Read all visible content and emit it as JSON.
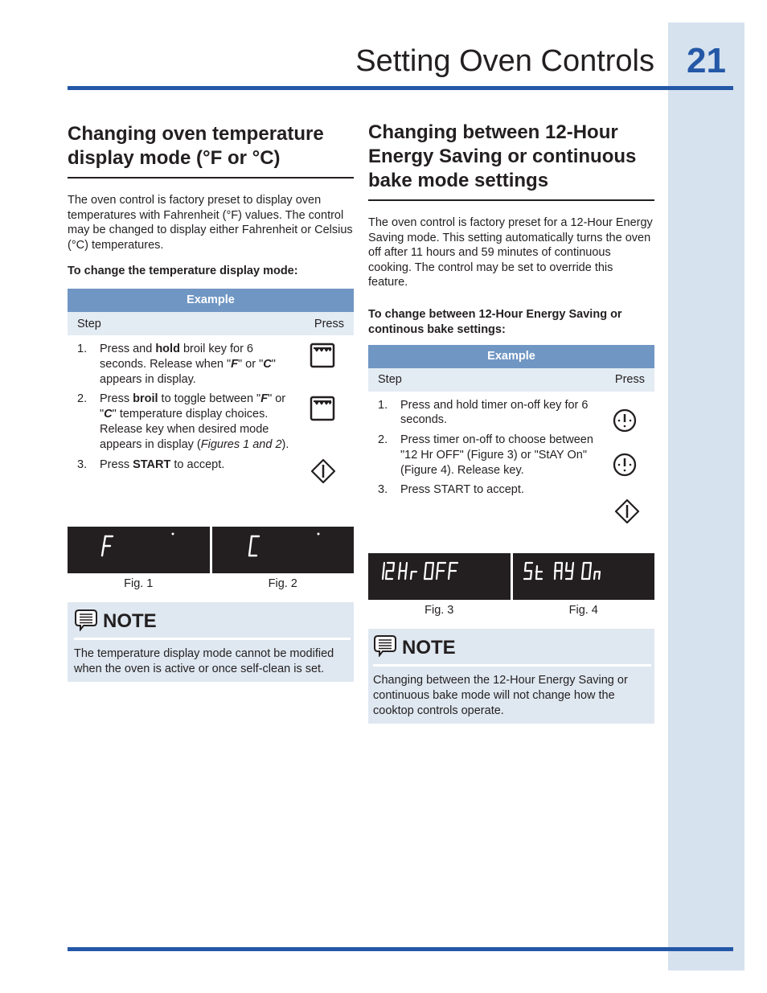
{
  "header": {
    "title": "Setting Oven Controls",
    "page_number": "21"
  },
  "left_section": {
    "heading": "Changing oven temperature display mode (°F or °C)",
    "intro": "The oven control is factory preset to display oven temperatures with Fahrenheit (°F) values. The control may be changed to display either Fahrenheit or Celsius (°C) temperatures.",
    "subheading": "To change the temperature display mode:",
    "table": {
      "title": "Example",
      "col_step": "Step",
      "col_press": "Press",
      "steps": [
        {
          "num": "1.",
          "parts": [
            [
              "",
              "Press and "
            ],
            [
              "b",
              "hold"
            ],
            [
              "",
              " broil key for 6 seconds. Release when \""
            ],
            [
              "bi",
              "F"
            ],
            [
              "",
              "\" or \""
            ],
            [
              "bi",
              "C"
            ],
            [
              "",
              "\" appears in display."
            ]
          ],
          "icon": "broil-key-icon"
        },
        {
          "num": "2.",
          "parts": [
            [
              "",
              "Press "
            ],
            [
              "b",
              "broil"
            ],
            [
              "",
              " to toggle between \""
            ],
            [
              "bi",
              "F"
            ],
            [
              "",
              "\" or \""
            ],
            [
              "bi",
              "C"
            ],
            [
              "",
              "\" temperature display choices. Release key when desired mode appears in display ("
            ],
            [
              "i",
              "Figures 1 and 2"
            ],
            [
              "",
              ")."
            ]
          ],
          "icon": "broil-key-icon"
        },
        {
          "num": "3.",
          "parts": [
            [
              "",
              "Press "
            ],
            [
              "b",
              "START"
            ],
            [
              "",
              " to accept."
            ]
          ],
          "icon": "start-key-icon"
        }
      ]
    },
    "figures": [
      {
        "display": "F",
        "label": "Fig. 1"
      },
      {
        "display": "C",
        "label": "Fig. 2"
      }
    ],
    "note": {
      "title": "NOTE",
      "text": "The temperature display mode cannot be modified when the oven is active or once self-clean is set."
    }
  },
  "right_section": {
    "heading": "Changing between 12-Hour Energy Saving  or continuous bake mode settings",
    "intro": "The oven control is factory preset for a 12-Hour Energy Saving mode. This setting automatically turns the oven off after 11 hours and 59 minutes of continuous cooking. The control may be set to override this feature.",
    "subheading": "To change between 12-Hour Energy Saving or continous bake settings:",
    "table": {
      "title": "Example",
      "col_step": "Step",
      "col_press": "Press",
      "steps": [
        {
          "num": "1.",
          "parts": [
            [
              "",
              "Press and hold timer on-off key for 6 seconds."
            ]
          ],
          "icon": "timer-key-icon"
        },
        {
          "num": "2.",
          "parts": [
            [
              "",
              "Press timer on-off to choose between \"12 Hr OFF\" (Figure 3) or \"StAY On\" (Figure 4). Release key."
            ]
          ],
          "icon": "timer-key-icon"
        },
        {
          "num": "3.",
          "parts": [
            [
              "",
              "Press START to accept."
            ]
          ],
          "icon": "start-key-icon"
        }
      ]
    },
    "figures": [
      {
        "display": "12 Hr OFF",
        "label": "Fig. 3"
      },
      {
        "display": "StAY On",
        "label": "Fig. 4"
      }
    ],
    "note": {
      "title": "NOTE",
      "text": "Changing between the 12-Hour Energy Saving or continuous bake mode will not change how the cooktop controls operate."
    }
  }
}
